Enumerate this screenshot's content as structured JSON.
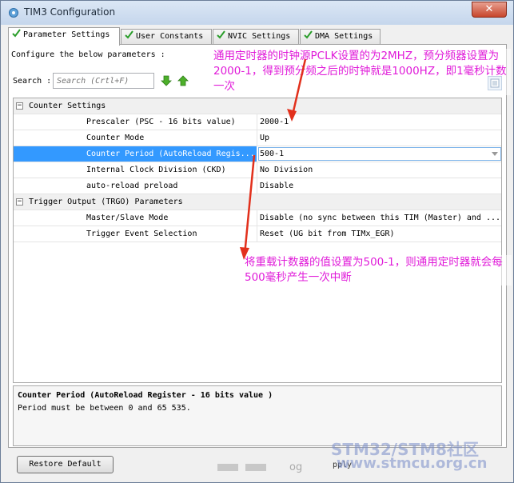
{
  "window": {
    "title": "TIM3 Configuration",
    "close_label": "✕"
  },
  "tabs": [
    {
      "label": "Parameter Settings",
      "active": true
    },
    {
      "label": "User Constants",
      "active": false
    },
    {
      "label": "NVIC Settings",
      "active": false
    },
    {
      "label": "DMA Settings",
      "active": false
    }
  ],
  "panel": {
    "configure_label": "Configure the below parameters :",
    "search_label": "Search :",
    "search_placeholder": "Search (Crtl+F)"
  },
  "grid": {
    "categories": [
      {
        "label": "Counter Settings",
        "rows": [
          {
            "name": "Prescaler (PSC - 16 bits value)",
            "value": "2000-1"
          },
          {
            "name": "Counter Mode",
            "value": "Up"
          },
          {
            "name": "Counter Period (AutoReload Regis...",
            "value": "500-1",
            "selected": true
          },
          {
            "name": "Internal Clock Division (CKD)",
            "value": "No Division"
          },
          {
            "name": "auto-reload preload",
            "value": "Disable"
          }
        ]
      },
      {
        "label": "Trigger Output (TRGO) Parameters",
        "rows": [
          {
            "name": "Master/Slave Mode",
            "value": "Disable (no sync between this TIM (Master) and ..."
          },
          {
            "name": "Trigger Event Selection",
            "value": "Reset (UG bit from TIMx_EGR)"
          }
        ]
      }
    ]
  },
  "description": {
    "title": "Counter Period (AutoReload Register - 16 bits value )",
    "text": "Period must be between 0 and 65 535."
  },
  "buttons": {
    "restore_default": "Restore Default",
    "apply": "pply",
    "og": "og"
  },
  "annotations": {
    "note1": "通用定时器的时钟源PCLK设置的为2MHZ，预分频器设置为2000-1，得到预分频之后的时钟就是1000HZ，即1毫秒计数一次",
    "note2": "将重载计数器的值设置为500-1，则通用定时器就会每500毫秒产生一次中断"
  },
  "watermark": {
    "line1": "STM32/STM8社区",
    "line2": "www.stmcu.org.cn"
  },
  "colors": {
    "selection": "#3399ff",
    "annotation": "#e01bd9",
    "arrow": "#e2301c"
  }
}
